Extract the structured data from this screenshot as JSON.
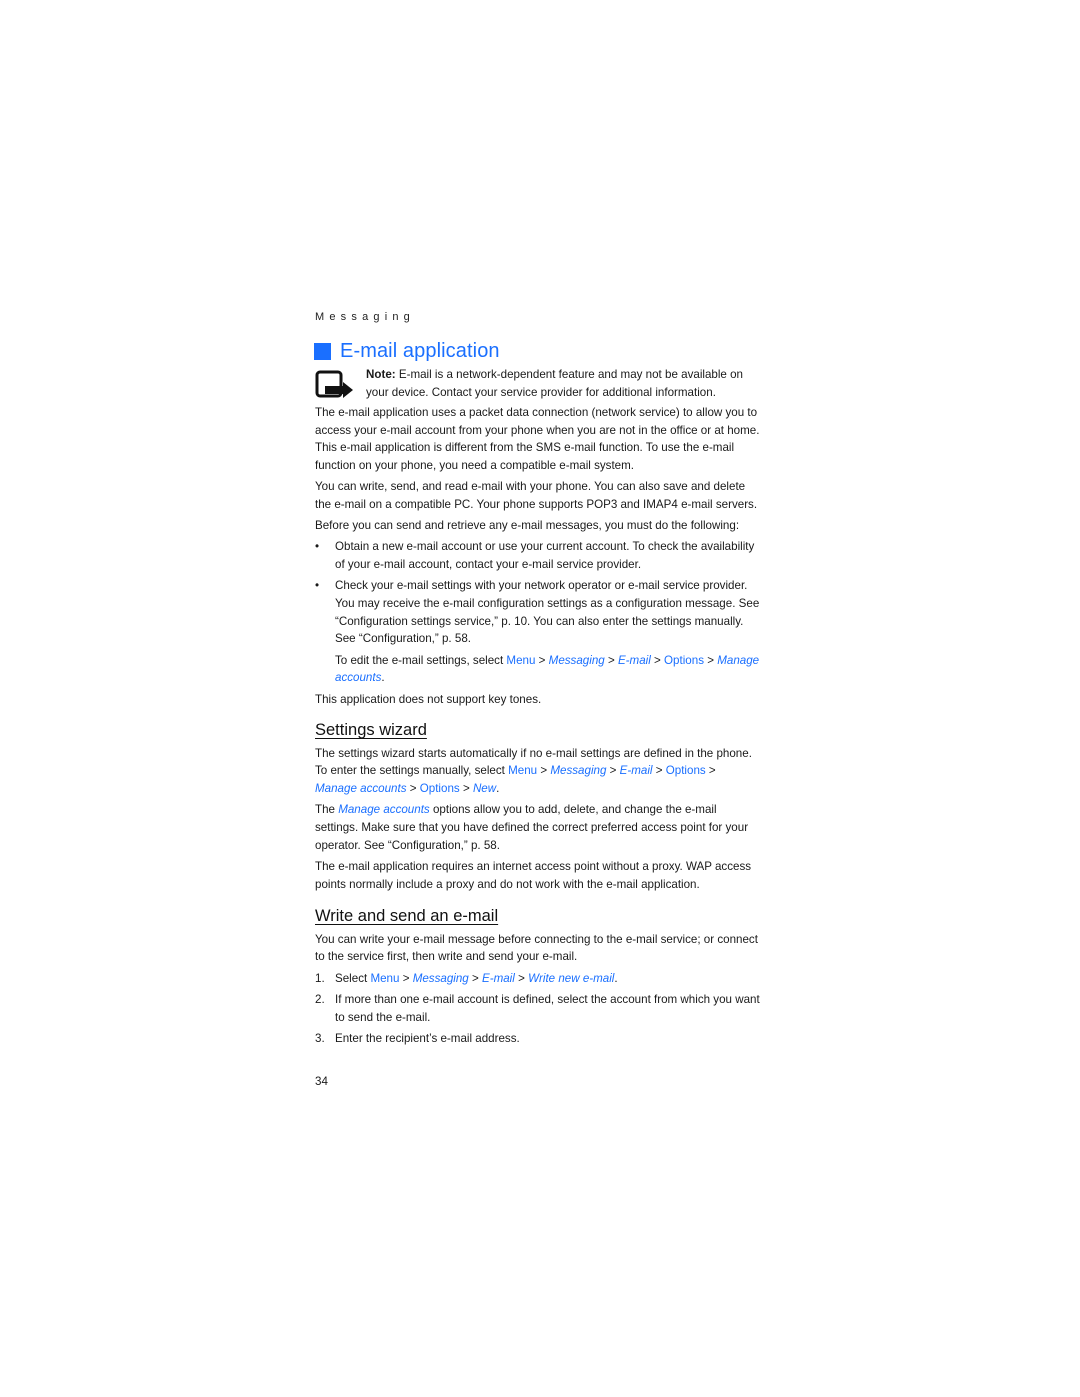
{
  "header": {
    "section": "Messaging"
  },
  "title": "E-mail application",
  "note": {
    "label": "Note:",
    "text": " E-mail is a network-dependent feature and may not be available on your device. Contact your service provider for additional information."
  },
  "intro": [
    "The e-mail application uses a packet data connection (network service) to allow you to access your e-mail account from your phone when you are not in the office or at home. This e-mail application is different from the SMS e-mail function. To use the e-mail function on your phone, you need a compatible e-mail system.",
    "You can write, send, and read e-mail with your phone. You can also save and delete the e-mail on a compatible PC. Your phone supports POP3 and IMAP4 e-mail servers.",
    "Before you can send and retrieve any e-mail messages, you must do the following:"
  ],
  "bullets": [
    "Obtain a new e-mail account or use your current account. To check the availability of your e-mail account, contact your e-mail service provider.",
    "Check your e-mail settings with your network operator or e-mail service provider. You may receive the e-mail configuration settings as a configuration message. See “Configuration settings service,” p. 10. You can also enter the settings manually. See “Configuration,” p. 58."
  ],
  "edit_settings": {
    "prefix": "To edit the e-mail settings, select ",
    "menu": "Menu",
    "sep": " > ",
    "messaging": "Messaging",
    "email": "E-mail",
    "options": "Options",
    "manage": "Manage accounts",
    "end": "."
  },
  "key_tones": "This application does not support key tones.",
  "settings_wizard": {
    "heading": "Settings wizard",
    "p1_prefix": "The settings wizard starts automatically if no e-mail settings are defined in the phone. To enter the settings manually, select ",
    "menu": "Menu",
    "messaging": "Messaging",
    "email": "E-mail",
    "options": "Options",
    "manage": "Manage accounts",
    "new": "New",
    "sep": " > ",
    "end": ".",
    "p2_prefix": "The ",
    "p2_link": "Manage accounts",
    "p2_rest": " options allow you to add, delete, and change the e-mail settings. Make sure that you have defined the correct preferred access point for your operator. See “Configuration,” p. 58.",
    "p3": "The e-mail application requires an internet access point without a proxy. WAP access points normally include a proxy and do not work with the e-mail application."
  },
  "write_send": {
    "heading": "Write and send an e-mail",
    "p1": "You can write your e-mail message before connecting to the e-mail service; or connect to the service first, then write and send your e-mail.",
    "steps": [
      {
        "n": "1.",
        "prefix": "Select ",
        "menu": "Menu",
        "messaging": "Messaging",
        "email": "E-mail",
        "write": "Write new e-mail",
        "end": "."
      },
      {
        "n": "2.",
        "text": "If more than one e-mail account is defined, select the account from which you want to send the e-mail."
      },
      {
        "n": "3.",
        "text": "Enter the recipient’s e-mail address."
      }
    ],
    "sep": " > "
  },
  "footer": {
    "page_number": "34"
  },
  "colors": {
    "accent": "#1a6fff"
  }
}
